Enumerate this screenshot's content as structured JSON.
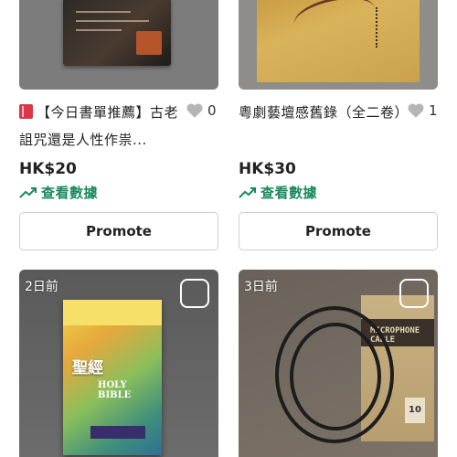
{
  "cards": [
    {
      "title": "【今日書單推薦】古老詛咒還是人性作祟...",
      "likes": "0",
      "price": "HK$20",
      "stats_label": "查看數據",
      "promote_label": "Promote"
    },
    {
      "title": "粵劇藝壇感舊錄（全二卷）",
      "likes": "1",
      "price": "HK$30",
      "stats_label": "查看數據",
      "promote_label": "Promote"
    },
    {
      "time_label": "2日前",
      "image_text": [
        "聖經",
        "HOLY BIBLE"
      ]
    },
    {
      "time_label": "3日前",
      "image_text": [
        "MICROPHONE CABLE",
        "10"
      ]
    }
  ],
  "colors": {
    "stats_green": "#1a8a5f",
    "heart_gray": "#b5b5b5",
    "promote_border": "#cfcfcf"
  },
  "icons": {
    "book": "red-book-icon",
    "heart": "heart-outline-icon",
    "trend": "trending-up-icon",
    "select": "checkbox-icon"
  }
}
